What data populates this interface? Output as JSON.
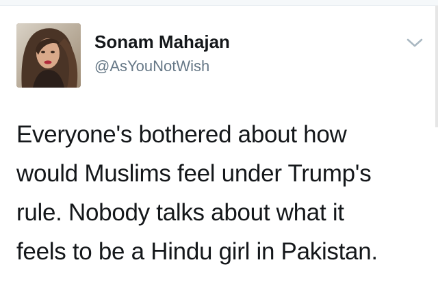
{
  "tweet": {
    "author": {
      "name": "Sonam Mahajan",
      "handle": "@AsYouNotWish",
      "avatar_icon": "profile-photo"
    },
    "menu_icon": "chevron-down-icon",
    "text_lines": [
      "Everyone's bothered about how",
      "would Muslims feel under Trump's",
      "rule. Nobody talks about what it",
      "feels to be a Hindu girl in Pakistan."
    ]
  },
  "colors": {
    "name": "#14171a",
    "handle": "#657786",
    "chevron": "#aab8c2",
    "background": "#ffffff"
  }
}
